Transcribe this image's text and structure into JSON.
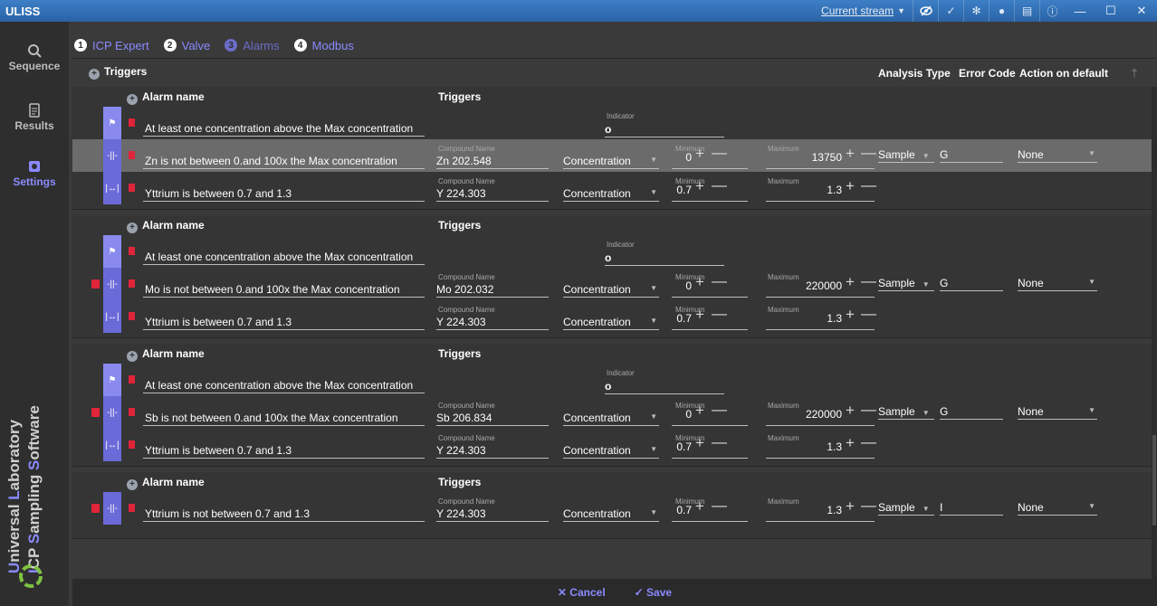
{
  "app": {
    "title": "ULISS",
    "stream_label": "Current stream",
    "icons": [
      "eye-off-icon",
      "check-icon",
      "gear-icon",
      "user-icon",
      "document-icon",
      "info-icon"
    ],
    "window": {
      "minimize": "—",
      "maximize": "☐",
      "close": "✕"
    }
  },
  "sidebar": {
    "items": [
      {
        "label": "Sequence",
        "icon": "search-icon"
      },
      {
        "label": "Results",
        "icon": "document-icon"
      },
      {
        "label": "Settings",
        "icon": "gear-icon"
      }
    ],
    "brand_line1": {
      "u": "U",
      "rest1": "niversal ",
      "l": "L",
      "rest2": "aboratory"
    },
    "brand_line2": {
      "i": "I",
      "rest1": "CP ",
      "s": "S",
      "rest2": "ampling ",
      "s2": "S",
      "rest3": "oftware"
    }
  },
  "tabs": [
    {
      "num": "1",
      "label": "ICP Expert"
    },
    {
      "num": "2",
      "label": "Valve"
    },
    {
      "num": "3",
      "label": "Alarms"
    },
    {
      "num": "4",
      "label": "Modbus"
    }
  ],
  "header": {
    "triggers": "Triggers",
    "analysis_type": "Analysis Type",
    "error_code": "Error Code",
    "action_on_default": "Action on default"
  },
  "labels": {
    "alarm_name": "Alarm name",
    "triggers": "Triggers",
    "indicator": "Indicator",
    "compound_name": "Compound Name",
    "minimum": "Minimum",
    "maximum": "Maximum",
    "plus": "+",
    "minus": "—"
  },
  "groups": [
    {
      "analysis_type": "Sample",
      "error_code": "G",
      "action": "None",
      "rows": [
        {
          "name": "At least one concentration above the Max concentration",
          "kind": "indicator",
          "indicator": "o"
        },
        {
          "name": "Zn is not between 0.and 100x the Max concentration",
          "kind": "range",
          "compound": "Zn 202.548",
          "type": "Concentration",
          "min": "0",
          "max": "13750"
        },
        {
          "name": "Yttrium is between 0.7 and 1.3",
          "kind": "range",
          "compound": "Y 224.303",
          "type": "Concentration",
          "min": "0.7",
          "max": "1.3"
        }
      ]
    },
    {
      "analysis_type": "Sample",
      "error_code": "G",
      "action": "None",
      "rows": [
        {
          "name": "At least one concentration above the Max concentration",
          "kind": "indicator",
          "indicator": "o"
        },
        {
          "name": "Mo is not between 0.and 100x the Max concentration",
          "kind": "range",
          "compound": "Mo 202.032",
          "type": "Concentration",
          "min": "0",
          "max": "220000"
        },
        {
          "name": "Yttrium is between 0.7 and 1.3",
          "kind": "range",
          "compound": "Y 224.303",
          "type": "Concentration",
          "min": "0.7",
          "max": "1.3"
        }
      ]
    },
    {
      "analysis_type": "Sample",
      "error_code": "G",
      "action": "None",
      "rows": [
        {
          "name": "At least one concentration above the Max concentration",
          "kind": "indicator",
          "indicator": "o"
        },
        {
          "name": "Sb is not between 0.and 100x the Max concentration",
          "kind": "range",
          "compound": "Sb 206.834",
          "type": "Concentration",
          "min": "0",
          "max": "220000"
        },
        {
          "name": "Yttrium is between 0.7 and 1.3",
          "kind": "range",
          "compound": "Y 224.303",
          "type": "Concentration",
          "min": "0.7",
          "max": "1.3"
        }
      ]
    },
    {
      "analysis_type": "Sample",
      "error_code": "I",
      "action": "None",
      "rows": [
        {
          "name": "Yttrium is not between 0.7 and 1.3",
          "kind": "range",
          "compound": "Y 224.303",
          "type": "Concentration",
          "min": "0.7",
          "max": "1.3"
        }
      ]
    }
  ],
  "footer": {
    "cancel": "✕ Cancel",
    "save": "✓ Save"
  },
  "colors": {
    "accent": "#8a8aff",
    "bar": "#6a6ad8",
    "delete": "#e0243a",
    "title_bar": "#2f6fb5"
  }
}
